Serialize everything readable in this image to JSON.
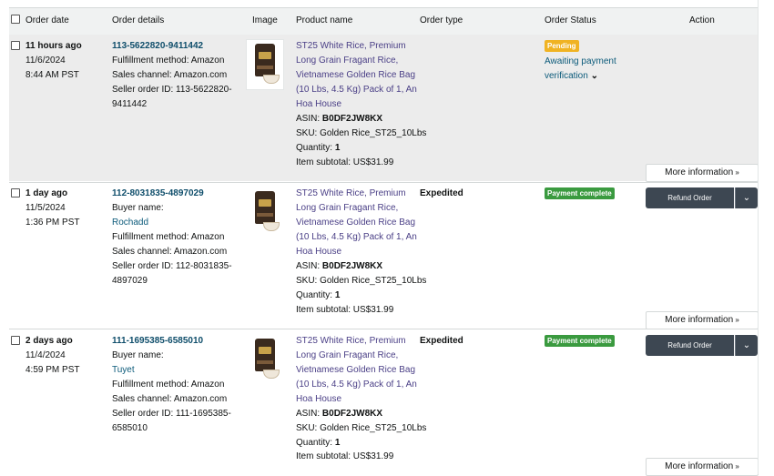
{
  "header": {
    "order_date": "Order date",
    "order_details": "Order details",
    "image": "Image",
    "product_name": "Product name",
    "order_type": "Order type",
    "order_status": "Order Status",
    "action": "Action"
  },
  "orders": [
    {
      "age": "11 hours ago",
      "date": "11/6/2024",
      "time": "8:44 AM PST",
      "order_id": "113-5622820-9411442",
      "buyer_label": "",
      "buyer_name": "",
      "fulfillment": "Fulfillment method: Amazon",
      "channel": "Sales channel: Amazon.com",
      "seller_id_line1": "Seller order ID: 113-5622820-",
      "seller_id_line2": "9411442",
      "product_lines": [
        "ST25 White Rice, Premium",
        "Long Grain Fragant Rice,",
        "Vietnamese Golden Rice Bag",
        "(10 Lbs, 4.5 Kg) Pack of 1, An",
        "Hoa House"
      ],
      "asin_label": "ASIN: ",
      "asin": "B0DF2JW8KX",
      "sku": "SKU: Golden Rice_ST25_10Lbs",
      "quantity_label": "Quantity: ",
      "quantity": "1",
      "subtotal": "Item subtotal: US$31.99",
      "order_type": "",
      "status_badge": "Pending",
      "status_line1": "Awaiting payment",
      "status_line2": "verification",
      "more_info": "More information",
      "refund": ""
    },
    {
      "age": "1 day ago",
      "date": "11/5/2024",
      "time": "1:36 PM PST",
      "order_id": "112-8031835-4897029",
      "buyer_label": "Buyer name:",
      "buyer_name": "Rochadd",
      "fulfillment": "Fulfillment method: Amazon",
      "channel": "Sales channel: Amazon.com",
      "seller_id_line1": "Seller order ID: 112-8031835-",
      "seller_id_line2": "4897029",
      "product_lines": [
        "ST25 White Rice, Premium",
        "Long Grain Fragant Rice,",
        "Vietnamese Golden Rice Bag",
        "(10 Lbs, 4.5 Kg) Pack of 1, An",
        "Hoa House"
      ],
      "asin_label": "ASIN: ",
      "asin": "B0DF2JW8KX",
      "sku": "SKU: Golden Rice_ST25_10Lbs",
      "quantity_label": "Quantity: ",
      "quantity": "1",
      "subtotal": "Item subtotal: US$31.99",
      "order_type": "Expedited",
      "status_badge": "Payment complete",
      "status_line1": "",
      "status_line2": "",
      "more_info": "More information",
      "refund": "Refund Order"
    },
    {
      "age": "2 days ago",
      "date": "11/4/2024",
      "time": "4:59 PM PST",
      "order_id": "111-1695385-6585010",
      "buyer_label": "Buyer name:",
      "buyer_name": "Tuyet",
      "fulfillment": "Fulfillment method: Amazon",
      "channel": "Sales channel: Amazon.com",
      "seller_id_line1": "Seller order ID: 111-1695385-",
      "seller_id_line2": "6585010",
      "product_lines": [
        "ST25 White Rice, Premium",
        "Long Grain Fragant Rice,",
        "Vietnamese Golden Rice Bag",
        "(10 Lbs, 4.5 Kg) Pack of 1, An",
        "Hoa House"
      ],
      "asin_label": "ASIN: ",
      "asin": "B0DF2JW8KX",
      "sku": "SKU: Golden Rice_ST25_10Lbs",
      "quantity_label": "Quantity: ",
      "quantity": "1",
      "subtotal": "Item subtotal: US$31.99",
      "order_type": "Expedited",
      "status_badge": "Payment complete",
      "status_line1": "",
      "status_line2": "",
      "more_info": "More information",
      "refund": "Refund Order"
    }
  ],
  "colors": {
    "pending": "#f0b323",
    "complete": "#3a9a3f",
    "link": "#0b5a7a",
    "product_link": "#4a3f86"
  }
}
